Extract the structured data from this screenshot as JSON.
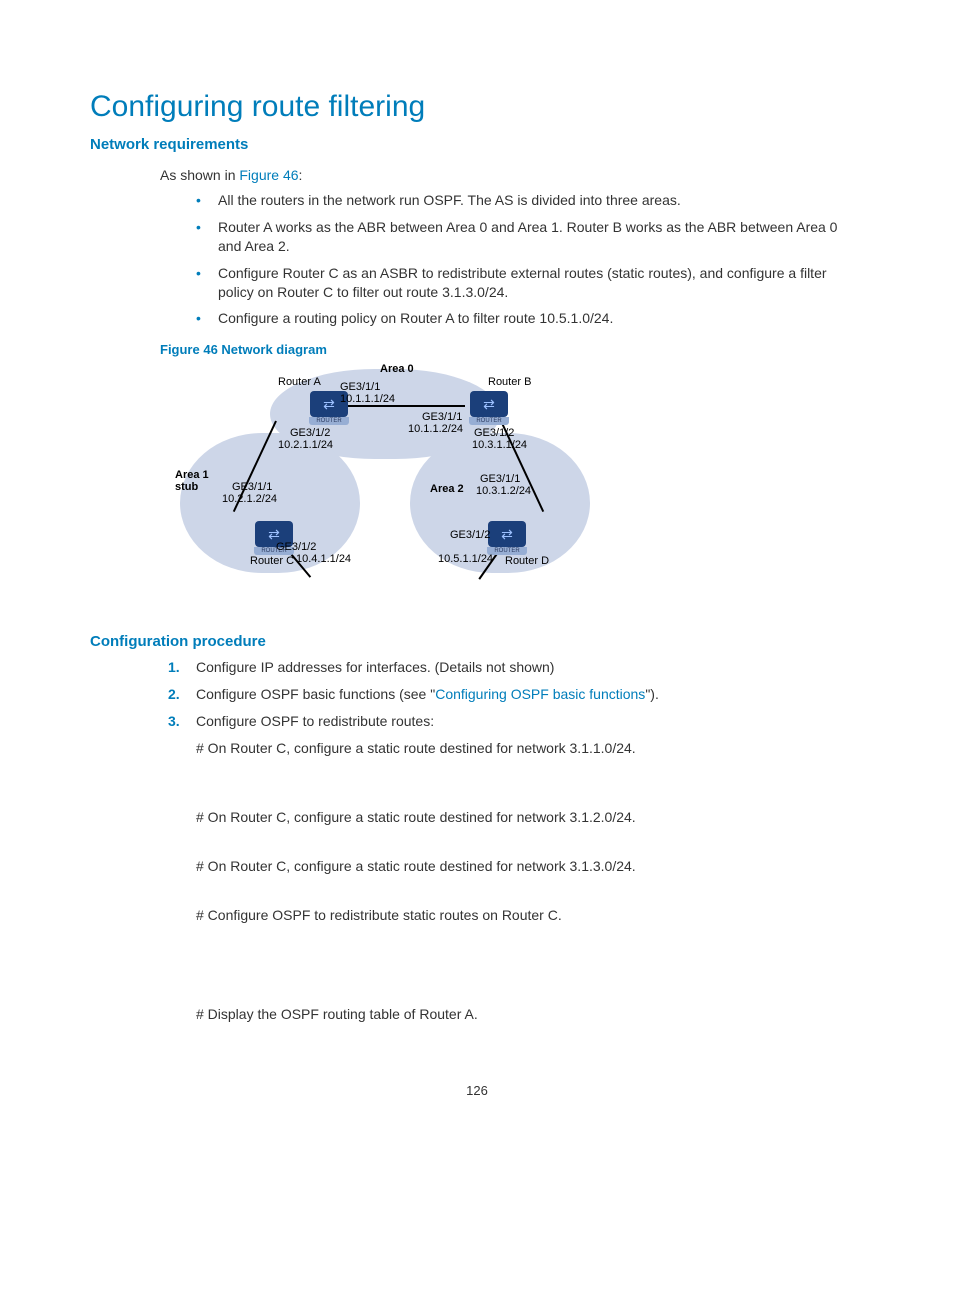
{
  "title": "Configuring route filtering",
  "section_req": "Network requirements",
  "intro_prefix": "As shown in ",
  "intro_link": "Figure 46",
  "intro_suffix": ":",
  "bullets": [
    "All the routers in the network run OSPF. The AS is divided into three areas.",
    "Router A works as the ABR between Area 0 and Area 1. Router B works as the ABR between Area 0 and Area 2.",
    "Configure Router C as an ASBR to redistribute external routes (static routes), and configure a filter policy on Router C to filter out route 3.1.3.0/24.",
    "Configure a routing policy on Router A to filter route 10.5.1.0/24."
  ],
  "fig_caption": "Figure 46 Network diagram",
  "diagram": {
    "area0": "Area 0",
    "area1_a": "Area 1",
    "area1_b": "stub",
    "area2": "Area 2",
    "routerA": "Router A",
    "routerB": "Router B",
    "routerC": "Router C",
    "routerD": "Router D",
    "rsub": "ROUTER",
    "ge311": "GE3/1/1",
    "ge312": "GE3/1/2",
    "ip_10_1_1_1": "10.1.1.1/24",
    "ip_10_1_1_2": "10.1.1.2/24",
    "ip_10_2_1_1": "10.2.1.1/24",
    "ip_10_2_1_2": "10.2.1.2/24",
    "ip_10_3_1_1": "10.3.1.1/24",
    "ip_10_3_1_2": "10.3.1.2/24",
    "ip_10_4_1_1": "10.4.1.1/24",
    "ip_10_5_1_1": "10.5.1.1/24"
  },
  "section_proc": "Configuration procedure",
  "steps": {
    "s1": "Configure IP addresses for interfaces. (Details not shown)",
    "s2_a": "Configure OSPF basic functions (see \"",
    "s2_link": "Configuring OSPF basic functions",
    "s2_b": "\").",
    "s3": "Configure OSPF to redistribute routes:",
    "s3_l1": "# On Router C, configure a static route destined for network 3.1.1.0/24.",
    "s3_l2": "# On Router C, configure a static route destined for network 3.1.2.0/24.",
    "s3_l3": "# On Router C, configure a static route destined for network 3.1.3.0/24.",
    "s3_l4": "# Configure OSPF to redistribute static routes on Router C.",
    "s3_l5": "# Display the OSPF routing table of Router A."
  },
  "page": "126"
}
